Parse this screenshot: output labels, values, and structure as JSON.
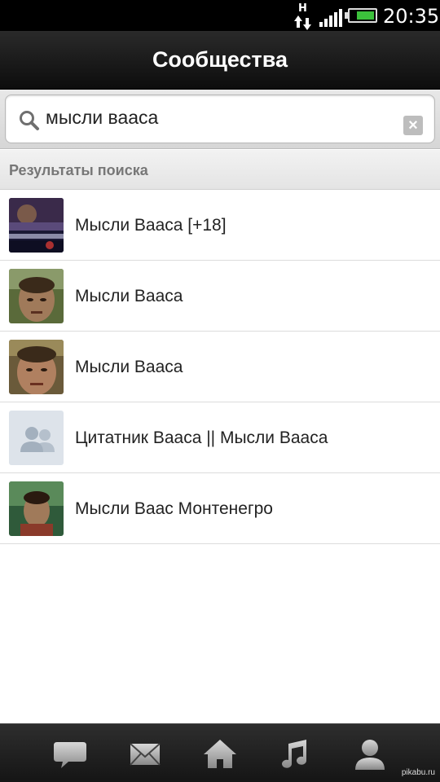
{
  "status_bar": {
    "network_type": "H",
    "time": "20:35",
    "battery_level": 0.75,
    "icons": [
      "data-arrows-icon",
      "signal-icon",
      "battery-icon"
    ]
  },
  "header": {
    "title": "Сообщества"
  },
  "search": {
    "value": "мысли вааса",
    "icons": [
      "search-icon",
      "clear-icon"
    ]
  },
  "results": {
    "section_label": "Результаты поиска",
    "items": [
      {
        "name": "Мысли Вааса [+18]",
        "thumb": "dark-poster"
      },
      {
        "name": "Мысли Вааса",
        "thumb": "character-portrait"
      },
      {
        "name": "Мысли Вааса",
        "thumb": "character-portrait"
      },
      {
        "name": "Цитатник Вааса || Мысли Вааса",
        "thumb": "default-community"
      },
      {
        "name": "Мысли Ваас Монтенегро",
        "thumb": "character-jungle"
      }
    ]
  },
  "bottom_nav": {
    "tabs": [
      "messages-icon",
      "mail-icon",
      "home-icon",
      "music-icon",
      "profile-icon"
    ]
  },
  "watermark": "pikabu.ru",
  "colors": {
    "status_bar": "#000000",
    "battery": "#3cc13c",
    "header_text": "#ffffff",
    "section_label": "#777777"
  }
}
